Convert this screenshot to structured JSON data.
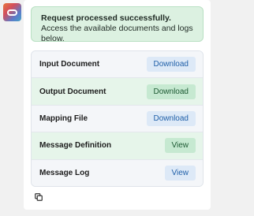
{
  "avatar": {
    "icon": "oracle-ring-logo"
  },
  "banner": {
    "title": "Request processed successfully.",
    "subtitle": "Access the available documents and logs below."
  },
  "rows": [
    {
      "label": "Input Document",
      "action": "Download",
      "style": "plain"
    },
    {
      "label": "Output Document",
      "action": "Download",
      "style": "green"
    },
    {
      "label": "Mapping File",
      "action": "Download",
      "style": "plain"
    },
    {
      "label": "Message Definition",
      "action": "View",
      "style": "green"
    },
    {
      "label": "Message Log",
      "action": "View",
      "style": "plain"
    }
  ],
  "footer": {
    "icon": "copy-icon"
  },
  "colors": {
    "success_bg": "#dcf1e1",
    "row_plain": "#f4f6f9",
    "row_green": "#e6f5ea",
    "button_blue_bg": "#dde9f7",
    "button_blue_text": "#1f5fa8",
    "button_green_bg": "#c6e9d1",
    "button_green_text": "#1d5a33"
  }
}
